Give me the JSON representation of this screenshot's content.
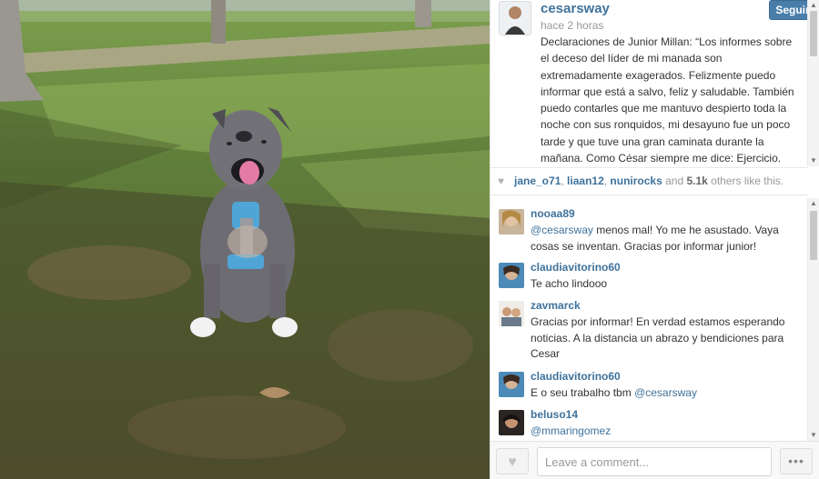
{
  "post": {
    "author": "cesarsway",
    "follow_label": "Seguir",
    "timestamp": "hace 2 horas",
    "caption": "Declaraciones de Junior Millan: “Los informes sobre el deceso del líder de mi manada son extremadamente exagerados. Felizmente puedo informar que está a salvo, feliz y saludable. También puedo contarles que me mantuvo despierto toda la noche con sus ronquidos, mi desayuno fue un poco tarde y que tuve una gran caminata durante la mañana. Como César siempre me dice: Ejercicio.",
    "photo_icon": "dog-photo"
  },
  "likes": {
    "users": [
      "jane_o71",
      "liaan12",
      "nunirocks"
    ],
    "sep1": ", ",
    "sep2": ", ",
    "and_text": " and ",
    "count": "5.1k",
    "suffix": " others like this."
  },
  "comments": [
    {
      "user": "nooaa89",
      "mention": "@cesarsway",
      "text": " menos mal! Yo me he asustado. Vaya cosas se inventan. Gracias por informar junior!"
    },
    {
      "user": "claudiavitorino60",
      "mention": "",
      "text": "Te acho lindooo"
    },
    {
      "user": "zavmarck",
      "mention": "",
      "text": "Gracias por informar! En verdad estamos esperando noticias. A la distancia un abrazo y bendiciones para Cesar"
    },
    {
      "user": "claudiavitorino60",
      "mention": "@cesarsway",
      "text": "E o seu trabalho tbm "
    },
    {
      "user": "beluso14",
      "mention": "@mmaringomez",
      "text": ""
    }
  ],
  "composer": {
    "placeholder": "Leave a comment...",
    "more_label": "•••"
  },
  "icons": {
    "heart": "heart-icon",
    "like_button": "heart-icon",
    "more": "ellipsis-icon",
    "scroll_up": "▲",
    "scroll_down": "▼"
  },
  "colors": {
    "link": "#3f729b",
    "follow_button": "#4a7eaa"
  }
}
